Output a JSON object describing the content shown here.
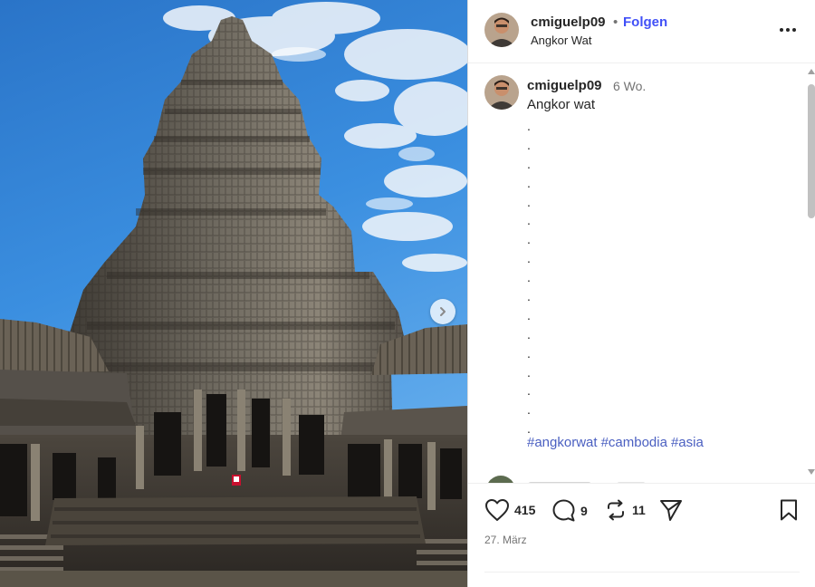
{
  "post": {
    "username": "cmiguelp09",
    "separator": "•",
    "follow_label": "Folgen",
    "location": "Angkor Wat",
    "more_icon": "more-horizontal-icon"
  },
  "caption": {
    "username": "cmiguelp09",
    "time_ago": "6 Wo.",
    "text": "Angkor wat",
    "dots": [
      ".",
      ".",
      ".",
      ".",
      ".",
      ".",
      ".",
      ".",
      ".",
      ".",
      ".",
      ".",
      ".",
      ".",
      ".",
      ".",
      "."
    ],
    "hashtags": [
      "#angkorwat",
      "#cambodia",
      "#asia"
    ]
  },
  "actions": {
    "likes": "415",
    "comments": "9",
    "reposts": "11",
    "like_icon": "heart-icon",
    "comment_icon": "comment-icon",
    "repost_icon": "repost-icon",
    "share_icon": "share-icon",
    "save_icon": "bookmark-icon"
  },
  "date": "27. März",
  "colors": {
    "follow": "#4150f7",
    "hashtag": "#4a5fc1",
    "sky": "#2f7fd3"
  }
}
